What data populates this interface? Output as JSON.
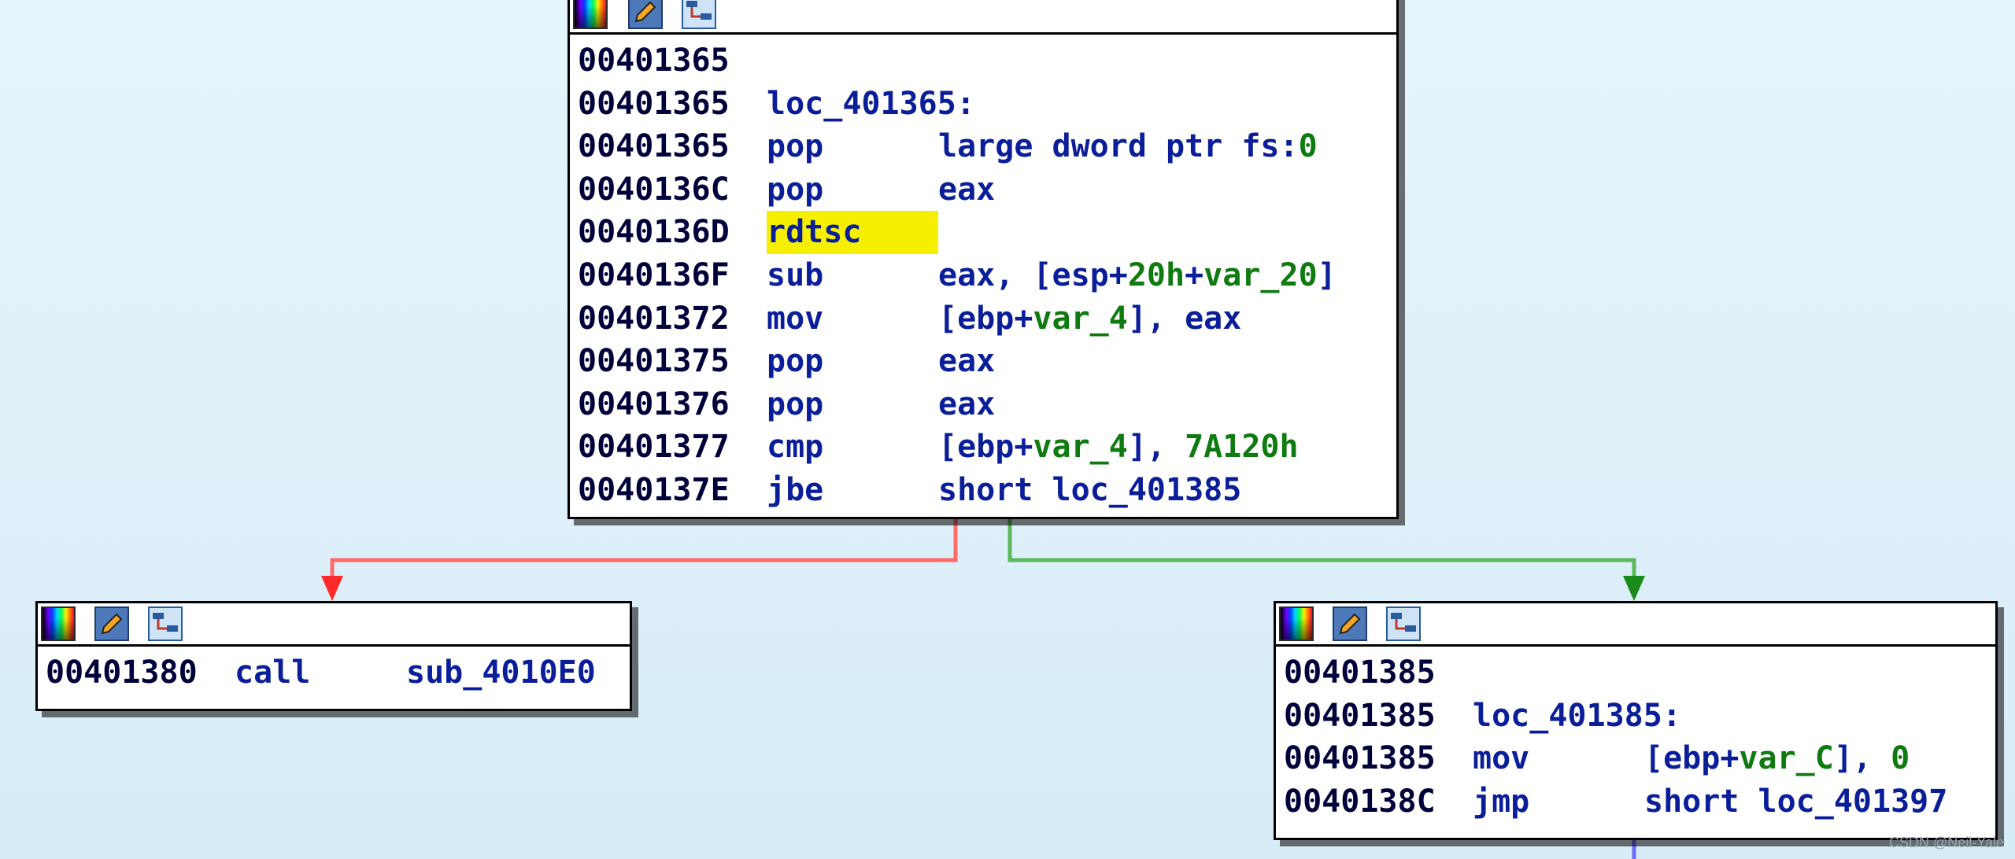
{
  "colors": {
    "background": "#e2f2fa",
    "true_edge": "#5cb85c",
    "false_edge": "#ff6b6b",
    "continuation_edge": "#6b6bff",
    "highlight": "#f6f000"
  },
  "toolbar_icons": [
    "color-palette-icon",
    "edit-pencil-icon",
    "graph-overview-icon"
  ],
  "blocks": {
    "top": {
      "lines": [
        {
          "addr": "00401365",
          "mn": "",
          "ops": ""
        },
        {
          "addr": "00401365",
          "mn": "loc_401365:",
          "ops": ""
        },
        {
          "addr": "00401365",
          "mn": "pop",
          "op_a": "large dword ptr fs:",
          "op_num": "0"
        },
        {
          "addr": "0040136C",
          "mn": "pop",
          "op_a": "eax"
        },
        {
          "addr": "0040136D",
          "mn": "rdtsc",
          "op_a": ""
        },
        {
          "addr": "0040136F",
          "mn": "sub",
          "op_a": "eax, [esp+",
          "op_num": "20h",
          "op_b": "+",
          "op_var": "var_20",
          "op_c": "]"
        },
        {
          "addr": "00401372",
          "mn": "mov",
          "op_a": "[ebp+",
          "op_var": "var_4",
          "op_c": "], eax"
        },
        {
          "addr": "00401375",
          "mn": "pop",
          "op_a": "eax"
        },
        {
          "addr": "00401376",
          "mn": "pop",
          "op_a": "eax"
        },
        {
          "addr": "00401377",
          "mn": "cmp",
          "op_a": "[ebp+",
          "op_var": "var_4",
          "op_c": "], ",
          "op_num": "7A120h"
        },
        {
          "addr": "0040137E",
          "mn": "jbe",
          "op_a": "short loc_401385"
        }
      ]
    },
    "left": {
      "lines": [
        {
          "addr": "00401380",
          "mn": "call",
          "op_a": "sub_4010E0"
        }
      ]
    },
    "right": {
      "lines": [
        {
          "addr": "00401385",
          "mn": ""
        },
        {
          "addr": "00401385",
          "mn": "loc_401385:"
        },
        {
          "addr": "00401385",
          "mn": "mov",
          "op_a": "[ebp+",
          "op_var": "var_C",
          "op_c": "], ",
          "op_num": "0"
        },
        {
          "addr": "0040138C",
          "mn": "jmp",
          "op_a": "short loc_401397"
        }
      ]
    }
  },
  "watermark": "CSDN @Neil-Yale"
}
